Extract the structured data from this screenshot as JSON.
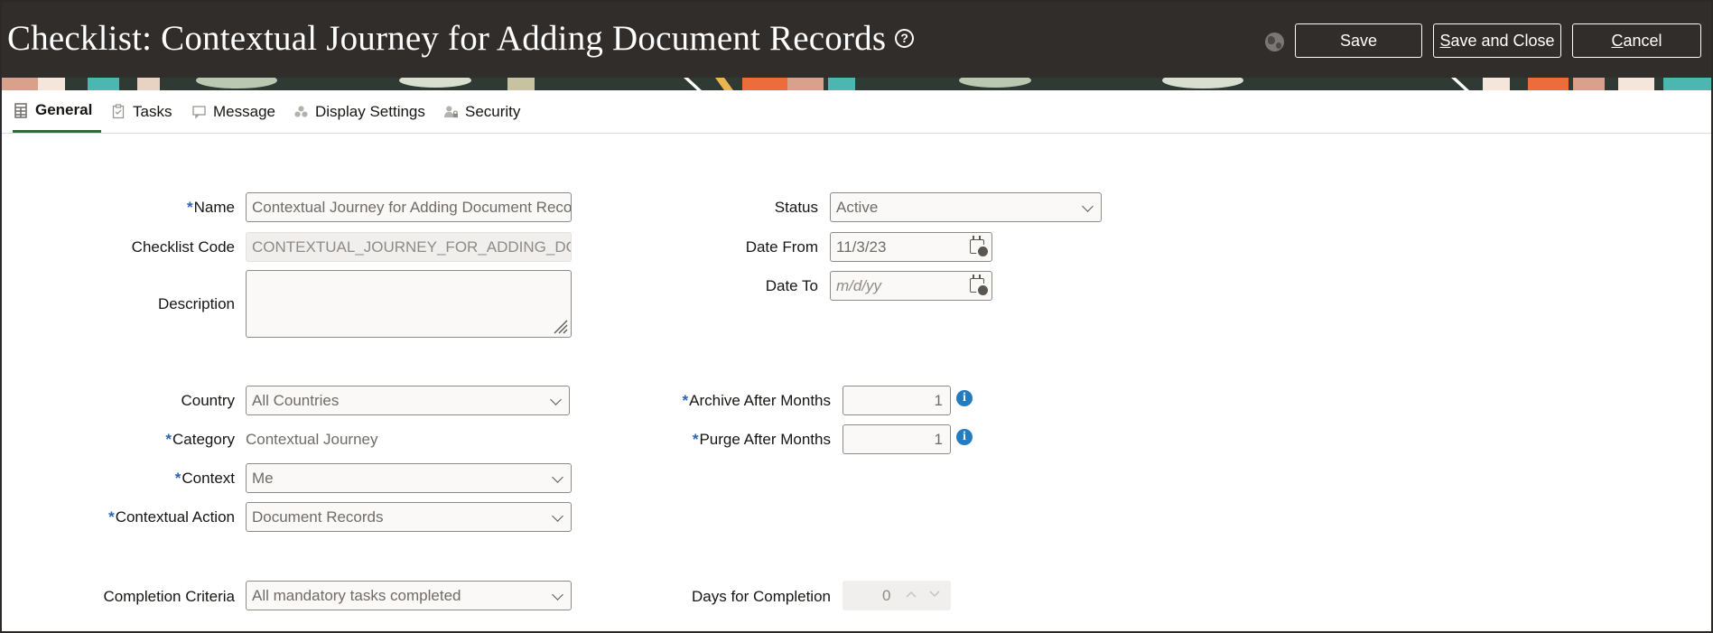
{
  "header": {
    "title": "Checklist: Contextual Journey for Adding Document Records",
    "help_icon": "?",
    "save_label": "Save",
    "save_close_label": "Save and Close",
    "cancel_label": "Cancel"
  },
  "tabs": [
    {
      "label": "General",
      "icon": "table-icon",
      "active": true
    },
    {
      "label": "Tasks",
      "icon": "clipboard-check-icon",
      "active": false
    },
    {
      "label": "Message",
      "icon": "chat-bubble-icon",
      "active": false
    },
    {
      "label": "Display Settings",
      "icon": "shapes-icon",
      "active": false
    },
    {
      "label": "Security",
      "icon": "user-lock-icon",
      "active": false
    }
  ],
  "form": {
    "name": {
      "label": "Name",
      "required": true,
      "value": "Contextual Journey for Adding Document Records"
    },
    "checklist_code": {
      "label": "Checklist Code",
      "value": "CONTEXTUAL_JOURNEY_FOR_ADDING_DOCUMENT_RECORDS"
    },
    "description": {
      "label": "Description",
      "value": ""
    },
    "status": {
      "label": "Status",
      "value": "Active"
    },
    "date_from": {
      "label": "Date From",
      "value": "11/3/23"
    },
    "date_to": {
      "label": "Date To",
      "placeholder": "m/d/yy"
    },
    "country": {
      "label": "Country",
      "value": "All Countries"
    },
    "category": {
      "label": "Category",
      "required": true,
      "value": "Contextual Journey"
    },
    "context": {
      "label": "Context",
      "required": true,
      "value": "Me"
    },
    "contextual_action": {
      "label": "Contextual Action",
      "required": true,
      "value": "Document Records"
    },
    "archive_after_months": {
      "label": "Archive After Months",
      "required": true,
      "value": "1"
    },
    "purge_after_months": {
      "label": "Purge After Months",
      "required": true,
      "value": "1"
    },
    "completion_criteria": {
      "label": "Completion Criteria",
      "value": "All mandatory tasks completed"
    },
    "days_for_completion": {
      "label": "Days for Completion",
      "value": "0"
    },
    "required_marker": "*"
  },
  "colors": {
    "header_bg": "#312d2a",
    "required": "#2a64b4",
    "info": "#227cbf",
    "active_tab_underline": "#2f6b3a"
  }
}
